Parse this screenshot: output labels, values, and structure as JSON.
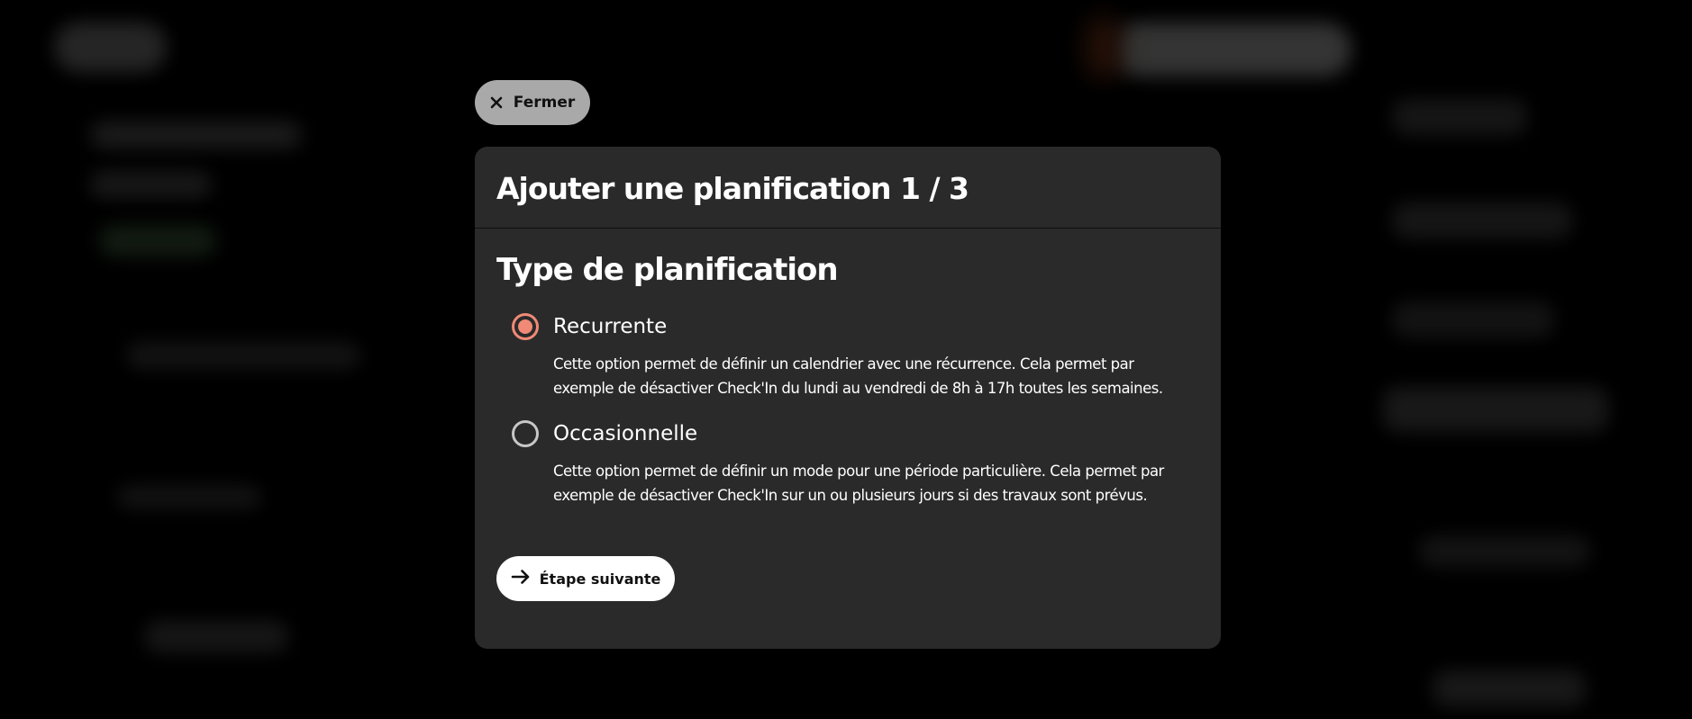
{
  "close_button": {
    "label": "Fermer",
    "icon": "close-icon"
  },
  "modal": {
    "title": "Ajouter une planification 1 / 3",
    "section_title": "Type de planification",
    "options": [
      {
        "label": "Recurrente",
        "description": "Cette option permet de définir un calendrier avec une récurrence. Cela permet par exemple de désactiver Check'In du lundi au vendredi de 8h à 17h toutes les semaines.",
        "selected": true
      },
      {
        "label": "Occasionnelle",
        "description": "Cette option permet de définir un mode pour une période particulière. Cela permet par exemple de désactiver Check'In sur un ou plusieurs jours si des travaux sont prévus.",
        "selected": false
      }
    ],
    "next_button": {
      "label": "Étape suivante",
      "icon": "arrow-right-icon"
    }
  },
  "colors": {
    "accent": "#f08a76",
    "modal_bg": "#2a2a2a",
    "close_bg": "#a9a9a9"
  }
}
